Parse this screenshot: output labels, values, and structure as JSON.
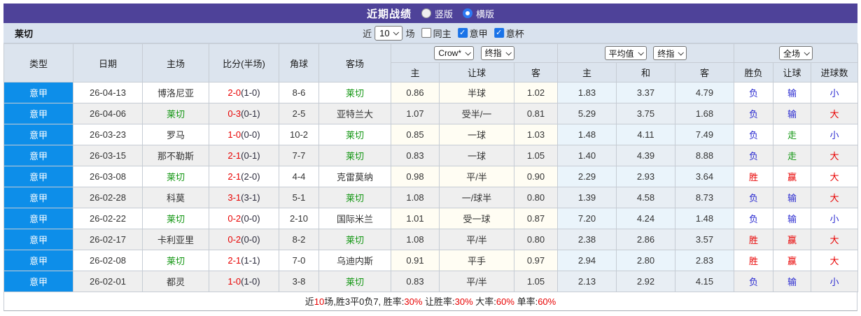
{
  "title_bar": {
    "title": "近期战绩",
    "radio_vertical": "竖版",
    "radio_horizontal": "横版",
    "selected": "横版"
  },
  "toolbar": {
    "team": "莱切",
    "near_label": "近",
    "matches_count": "10",
    "matches_label": "场",
    "checkboxes": [
      {
        "label": "同主",
        "checked": false
      },
      {
        "label": "意甲",
        "checked": true
      },
      {
        "label": "意杯",
        "checked": true
      }
    ]
  },
  "table": {
    "headers": {
      "type": "类型",
      "date": "日期",
      "home": "主场",
      "score": "比分(半场)",
      "corner": "角球",
      "away": "客场",
      "asian_select_bookmaker": "Crow*",
      "asian_select_stage": "终指",
      "euro_select_avg": "平均值",
      "euro_select_stage": "终指",
      "full_select_scope": "全场",
      "asian_home": "主",
      "asian_handicap": "让球",
      "asian_away": "客",
      "euro_home": "主",
      "euro_draw": "和",
      "euro_away": "客",
      "result": "胜负",
      "handicap_result": "让球",
      "goals": "进球数"
    },
    "rows": [
      {
        "league": "意甲",
        "date": "26-04-13",
        "home": {
          "text": "博洛尼亚",
          "color": ""
        },
        "score_main": "2-0",
        "score_half": "(1-0)",
        "corner": "8-6",
        "away": {
          "text": "莱切",
          "color": "green"
        },
        "asian_home": "0.86",
        "asian_line": "半球",
        "asian_away": "1.02",
        "euro_home": "1.83",
        "euro_draw": "3.37",
        "euro_away": "4.79",
        "result": {
          "text": "负",
          "color": "blue"
        },
        "handicap": {
          "text": "输",
          "color": "blue"
        },
        "goals": {
          "text": "小",
          "color": "blue"
        }
      },
      {
        "league": "意甲",
        "date": "26-04-06",
        "home": {
          "text": "莱切",
          "color": "green"
        },
        "score_main": "0-3",
        "score_half": "(0-1)",
        "corner": "2-5",
        "away": {
          "text": "亚特兰大",
          "color": ""
        },
        "asian_home": "1.07",
        "asian_line": "受半/一",
        "asian_away": "0.81",
        "euro_home": "5.29",
        "euro_draw": "3.75",
        "euro_away": "1.68",
        "result": {
          "text": "负",
          "color": "blue"
        },
        "handicap": {
          "text": "输",
          "color": "blue"
        },
        "goals": {
          "text": "大",
          "color": "red"
        }
      },
      {
        "league": "意甲",
        "date": "26-03-23",
        "home": {
          "text": "罗马",
          "color": ""
        },
        "score_main": "1-0",
        "score_half": "(0-0)",
        "corner": "10-2",
        "away": {
          "text": "莱切",
          "color": "green"
        },
        "asian_home": "0.85",
        "asian_line": "一球",
        "asian_away": "1.03",
        "euro_home": "1.48",
        "euro_draw": "4.11",
        "euro_away": "7.49",
        "result": {
          "text": "负",
          "color": "blue"
        },
        "handicap": {
          "text": "走",
          "color": "green"
        },
        "goals": {
          "text": "小",
          "color": "blue"
        }
      },
      {
        "league": "意甲",
        "date": "26-03-15",
        "home": {
          "text": "那不勒斯",
          "color": ""
        },
        "score_main": "2-1",
        "score_half": "(0-1)",
        "corner": "7-7",
        "away": {
          "text": "莱切",
          "color": "green"
        },
        "asian_home": "0.83",
        "asian_line": "一球",
        "asian_away": "1.05",
        "euro_home": "1.40",
        "euro_draw": "4.39",
        "euro_away": "8.88",
        "result": {
          "text": "负",
          "color": "blue"
        },
        "handicap": {
          "text": "走",
          "color": "green"
        },
        "goals": {
          "text": "大",
          "color": "red"
        }
      },
      {
        "league": "意甲",
        "date": "26-03-08",
        "home": {
          "text": "莱切",
          "color": "green"
        },
        "score_main": "2-1",
        "score_half": "(2-0)",
        "corner": "4-4",
        "away": {
          "text": "克雷莫纳",
          "color": ""
        },
        "asian_home": "0.98",
        "asian_line": "平/半",
        "asian_away": "0.90",
        "euro_home": "2.29",
        "euro_draw": "2.93",
        "euro_away": "3.64",
        "result": {
          "text": "胜",
          "color": "red"
        },
        "handicap": {
          "text": "赢",
          "color": "red"
        },
        "goals": {
          "text": "大",
          "color": "red"
        }
      },
      {
        "league": "意甲",
        "date": "26-02-28",
        "home": {
          "text": "科莫",
          "color": ""
        },
        "score_main": "3-1",
        "score_half": "(3-1)",
        "corner": "5-1",
        "away": {
          "text": "莱切",
          "color": "green"
        },
        "asian_home": "1.08",
        "asian_line": "一/球半",
        "asian_away": "0.80",
        "euro_home": "1.39",
        "euro_draw": "4.58",
        "euro_away": "8.73",
        "result": {
          "text": "负",
          "color": "blue"
        },
        "handicap": {
          "text": "输",
          "color": "blue"
        },
        "goals": {
          "text": "大",
          "color": "red"
        }
      },
      {
        "league": "意甲",
        "date": "26-02-22",
        "home": {
          "text": "莱切",
          "color": "green"
        },
        "score_main": "0-2",
        "score_half": "(0-0)",
        "corner": "2-10",
        "away": {
          "text": "国际米兰",
          "color": ""
        },
        "asian_home": "1.01",
        "asian_line": "受一球",
        "asian_away": "0.87",
        "euro_home": "7.20",
        "euro_draw": "4.24",
        "euro_away": "1.48",
        "result": {
          "text": "负",
          "color": "blue"
        },
        "handicap": {
          "text": "输",
          "color": "blue"
        },
        "goals": {
          "text": "小",
          "color": "blue"
        }
      },
      {
        "league": "意甲",
        "date": "26-02-17",
        "home": {
          "text": "卡利亚里",
          "color": ""
        },
        "score_main": "0-2",
        "score_half": "(0-0)",
        "corner": "8-2",
        "away": {
          "text": "莱切",
          "color": "green"
        },
        "asian_home": "1.08",
        "asian_line": "平/半",
        "asian_away": "0.80",
        "euro_home": "2.38",
        "euro_draw": "2.86",
        "euro_away": "3.57",
        "result": {
          "text": "胜",
          "color": "red"
        },
        "handicap": {
          "text": "赢",
          "color": "red"
        },
        "goals": {
          "text": "大",
          "color": "red"
        }
      },
      {
        "league": "意甲",
        "date": "26-02-08",
        "home": {
          "text": "莱切",
          "color": "green"
        },
        "score_main": "2-1",
        "score_half": "(1-1)",
        "corner": "7-0",
        "away": {
          "text": "乌迪内斯",
          "color": ""
        },
        "asian_home": "0.91",
        "asian_line": "平手",
        "asian_away": "0.97",
        "euro_home": "2.94",
        "euro_draw": "2.80",
        "euro_away": "2.83",
        "result": {
          "text": "胜",
          "color": "red"
        },
        "handicap": {
          "text": "赢",
          "color": "red"
        },
        "goals": {
          "text": "大",
          "color": "red"
        }
      },
      {
        "league": "意甲",
        "date": "26-02-01",
        "home": {
          "text": "都灵",
          "color": ""
        },
        "score_main": "1-0",
        "score_half": "(1-0)",
        "corner": "3-8",
        "away": {
          "text": "莱切",
          "color": "green"
        },
        "asian_home": "0.83",
        "asian_line": "平/半",
        "asian_away": "1.05",
        "euro_home": "2.13",
        "euro_draw": "2.92",
        "euro_away": "4.15",
        "result": {
          "text": "负",
          "color": "blue"
        },
        "handicap": {
          "text": "输",
          "color": "blue"
        },
        "goals": {
          "text": "小",
          "color": "blue"
        }
      }
    ]
  },
  "summary": {
    "segments": [
      {
        "text": "近",
        "color": ""
      },
      {
        "text": "10",
        "color": "red"
      },
      {
        "text": "场,胜3平0负7, 胜率:",
        "color": ""
      },
      {
        "text": "30%",
        "color": "red"
      },
      {
        "text": " 让胜率:",
        "color": ""
      },
      {
        "text": "30%",
        "color": "red"
      },
      {
        "text": " 大率:",
        "color": ""
      },
      {
        "text": "60%",
        "color": "red"
      },
      {
        "text": " 单率:",
        "color": ""
      },
      {
        "text": "60%",
        "color": "red"
      }
    ]
  }
}
